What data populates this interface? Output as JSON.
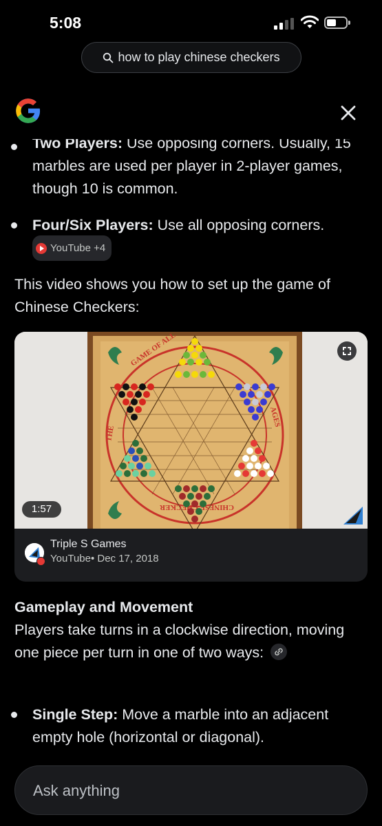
{
  "status_bar": {
    "time": "5:08"
  },
  "search": {
    "query": "how to play chinese checkers"
  },
  "content": {
    "bullets_top": [
      {
        "bold": "Two Players:",
        "text": " Use opposing corners. Usually, 15 marbles are used per player in 2-player games, though 10 is common."
      },
      {
        "bold": "Four/Six Players:",
        "text": " Use all opposing corners."
      }
    ],
    "source_chip": {
      "label": "YouTube +4"
    },
    "intro_text": "This video shows you how to set up the game of Chinese Checkers:",
    "video": {
      "duration": "1:57",
      "channel": "Triple S Games",
      "meta": "YouTube• Dec 17, 2018",
      "board_text": {
        "top": "GAME OF ALL",
        "left": "THE",
        "right": "AGES",
        "bottom": "CHINESE CHECKER"
      }
    },
    "section_title": "Gameplay and Movement",
    "section_text": "Players take turns in a clockwise direction, moving one piece per turn in one of two ways:",
    "bullets_bottom": [
      {
        "bold": "Single Step:",
        "text": " Move a marble into an adjacent empty hole (horizontal or diagonal)."
      }
    ]
  },
  "ask_bar": {
    "placeholder": "Ask anything"
  },
  "colors": {
    "background": "#000000",
    "text": "#e8eaed",
    "youtube_red": "#e53935",
    "card": "#1c1d20"
  }
}
